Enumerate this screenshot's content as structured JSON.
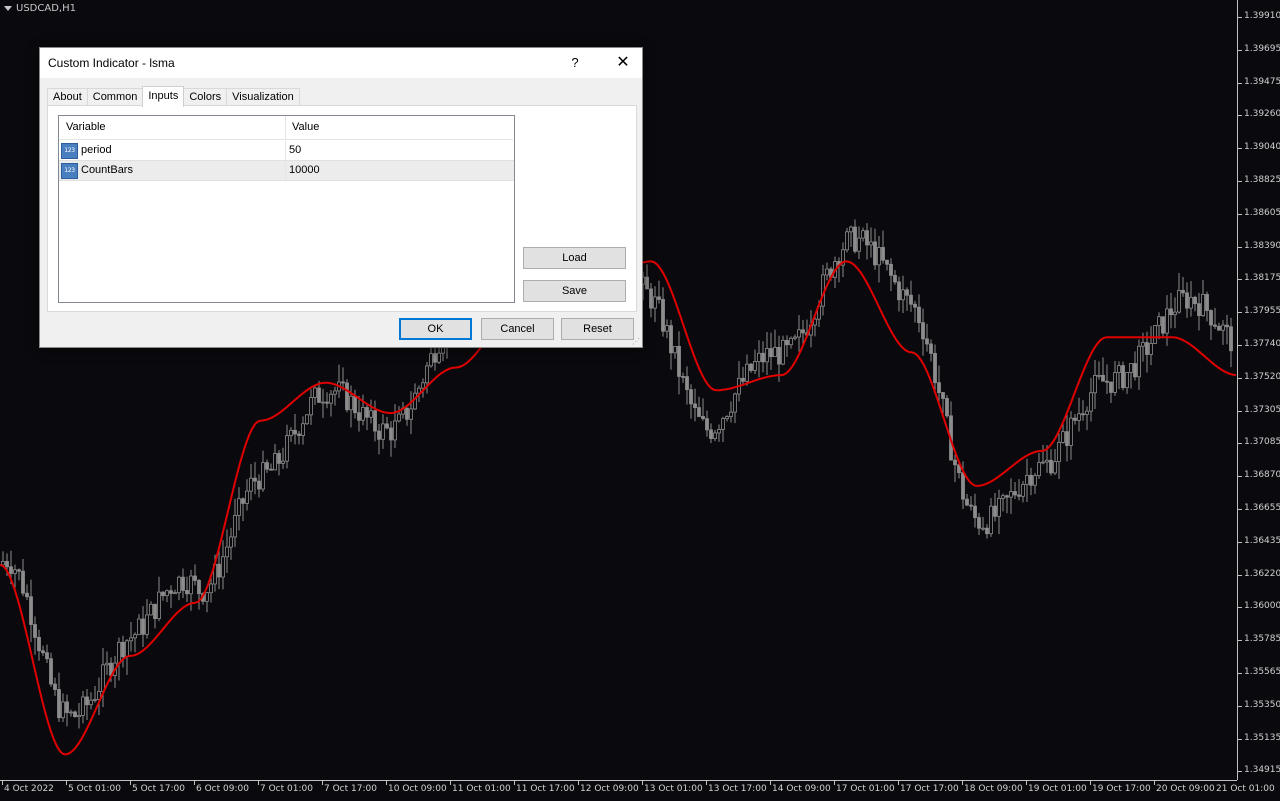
{
  "chart": {
    "symbol": "USDCAD,H1",
    "price_axis": [
      "1.39910",
      "1.39695",
      "1.39475",
      "1.39260",
      "1.39040",
      "1.38825",
      "1.38605",
      "1.38390",
      "1.38175",
      "1.37955",
      "1.37740",
      "1.37520",
      "1.37305",
      "1.37085",
      "1.36870",
      "1.36655",
      "1.36435",
      "1.36220",
      "1.36000",
      "1.35785",
      "1.35565",
      "1.35350",
      "1.35135",
      "1.34915"
    ],
    "time_axis": [
      "4 Oct 2022",
      "5 Oct 01:00",
      "5 Oct 17:00",
      "6 Oct 09:00",
      "7 Oct 01:00",
      "7 Oct 17:00",
      "10 Oct 09:00",
      "11 Oct 01:00",
      "11 Oct 17:00",
      "12 Oct 09:00",
      "13 Oct 01:00",
      "13 Oct 17:00",
      "14 Oct 09:00",
      "17 Oct 01:00",
      "17 Oct 17:00",
      "18 Oct 09:00",
      "19 Oct 01:00",
      "19 Oct 17:00",
      "20 Oct 09:00",
      "21 Oct 01:00"
    ],
    "colors": {
      "background": "#0a0a0e",
      "candles": "#8c8c8c",
      "indicator": "#e00000",
      "axis": "#c0c0c0"
    }
  },
  "chart_data": {
    "type": "line",
    "title": "USDCAD,H1",
    "ylim": [
      1.34915,
      1.3991
    ],
    "series": [
      {
        "name": "lsma",
        "x": [
          "4 Oct 2022",
          "5 Oct 01:00",
          "5 Oct 17:00",
          "6 Oct 09:00",
          "7 Oct 01:00",
          "7 Oct 17:00",
          "10 Oct 09:00",
          "11 Oct 01:00",
          "11 Oct 17:00",
          "12 Oct 09:00",
          "13 Oct 01:00",
          "13 Oct 17:00",
          "14 Oct 09:00",
          "17 Oct 01:00",
          "17 Oct 17:00",
          "18 Oct 09:00",
          "19 Oct 01:00",
          "19 Oct 17:00",
          "20 Oct 09:00",
          "21 Oct 01:00"
        ],
        "values": [
          1.363,
          1.3505,
          1.357,
          1.3605,
          1.3725,
          1.375,
          1.373,
          1.376,
          1.38,
          1.3812,
          1.383,
          1.3745,
          1.3755,
          1.383,
          1.377,
          1.3682,
          1.3705,
          1.378,
          1.378,
          1.3755
        ]
      }
    ]
  },
  "dialog": {
    "title": "Custom Indicator - lsma",
    "help": "?",
    "close": "✕",
    "tabs": [
      "About",
      "Common",
      "Inputs",
      "Colors",
      "Visualization"
    ],
    "active_tab": "Inputs",
    "table": {
      "headers": {
        "variable": "Variable",
        "value": "Value"
      },
      "rows": [
        {
          "icon": "123",
          "name": "period",
          "value": "50"
        },
        {
          "icon": "123",
          "name": "CountBars",
          "value": "10000"
        }
      ]
    },
    "buttons": {
      "load": "Load",
      "save": "Save",
      "ok": "OK",
      "cancel": "Cancel",
      "reset": "Reset"
    }
  }
}
